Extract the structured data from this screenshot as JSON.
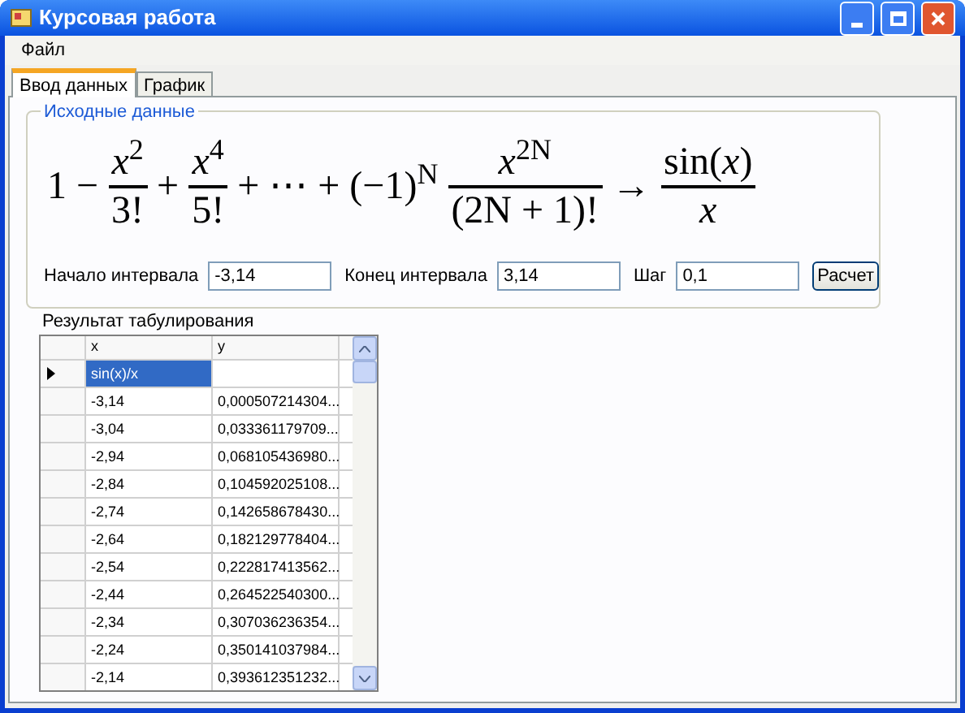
{
  "window": {
    "title": "Курсовая работа"
  },
  "menu": [
    {
      "label": "Файл"
    }
  ],
  "tabs": [
    {
      "label": "Ввод данных",
      "selected": true
    },
    {
      "label": "График",
      "selected": false
    }
  ],
  "group": {
    "title": "Исходные данные",
    "formula": [
      {
        "kind": "text",
        "text": "1 −"
      },
      {
        "kind": "fraction",
        "num": "*x*$^{2}$",
        "den": "3!"
      },
      {
        "kind": "text",
        "text": "+"
      },
      {
        "kind": "fraction",
        "num": "*x*$^{4}$",
        "den": "5!"
      },
      {
        "kind": "text",
        "text": "+ ⋯ + (−1)$^{N}$"
      },
      {
        "kind": "fraction",
        "num": "*x*$^{2N}$",
        "den": "(2N + 1)!"
      },
      {
        "kind": "text",
        "text": "→"
      },
      {
        "kind": "fraction",
        "num": "sin(*x*)",
        "den": "*x*"
      }
    ],
    "fields": [
      {
        "label": "Начало интервала",
        "value": "-3,14"
      },
      {
        "label": "Конец интервала",
        "value": "3,14"
      },
      {
        "label": "Шаг",
        "value": "0,1"
      }
    ],
    "button": "Расчет"
  },
  "result": {
    "title": "Результат табулирования",
    "columns": [
      "x",
      "y"
    ],
    "rows": [
      {
        "current": true,
        "cells": [
          {
            "text": "sin(x)/x",
            "selected": true
          },
          {
            "selected": false
          }
        ]
      },
      {
        "current": false,
        "cells": [
          {
            "text": "-3,14",
            "selected": false
          },
          {
            "text": "0,000507214304...",
            "selected": false
          }
        ]
      },
      {
        "current": false,
        "cells": [
          {
            "text": "-3,04",
            "selected": false
          },
          {
            "text": "0,033361179709...",
            "selected": false
          }
        ]
      },
      {
        "current": false,
        "cells": [
          {
            "text": "-2,94",
            "selected": false
          },
          {
            "text": "0,068105436980...",
            "selected": false
          }
        ]
      },
      {
        "current": false,
        "cells": [
          {
            "text": "-2,84",
            "selected": false
          },
          {
            "text": "0,104592025108...",
            "selected": false
          }
        ]
      },
      {
        "current": false,
        "cells": [
          {
            "text": "-2,74",
            "selected": false
          },
          {
            "text": "0,142658678430...",
            "selected": false
          }
        ]
      },
      {
        "current": false,
        "cells": [
          {
            "text": "-2,64",
            "selected": false
          },
          {
            "text": "0,182129778404...",
            "selected": false
          }
        ]
      },
      {
        "current": false,
        "cells": [
          {
            "text": "-2,54",
            "selected": false
          },
          {
            "text": "0,222817413562...",
            "selected": false
          }
        ]
      },
      {
        "current": false,
        "cells": [
          {
            "text": "-2,44",
            "selected": false
          },
          {
            "text": "0,264522540300...",
            "selected": false
          }
        ]
      },
      {
        "current": false,
        "cells": [
          {
            "text": "-2,34",
            "selected": false
          },
          {
            "text": "0,307036236354...",
            "selected": false
          }
        ]
      },
      {
        "current": false,
        "cells": [
          {
            "text": "-2,24",
            "selected": false
          },
          {
            "text": "0,350141037984...",
            "selected": false
          }
        ]
      },
      {
        "current": false,
        "cells": [
          {
            "text": "-2,14",
            "selected": false
          },
          {
            "text": "0,393612351232...",
            "selected": false
          }
        ]
      }
    ]
  }
}
